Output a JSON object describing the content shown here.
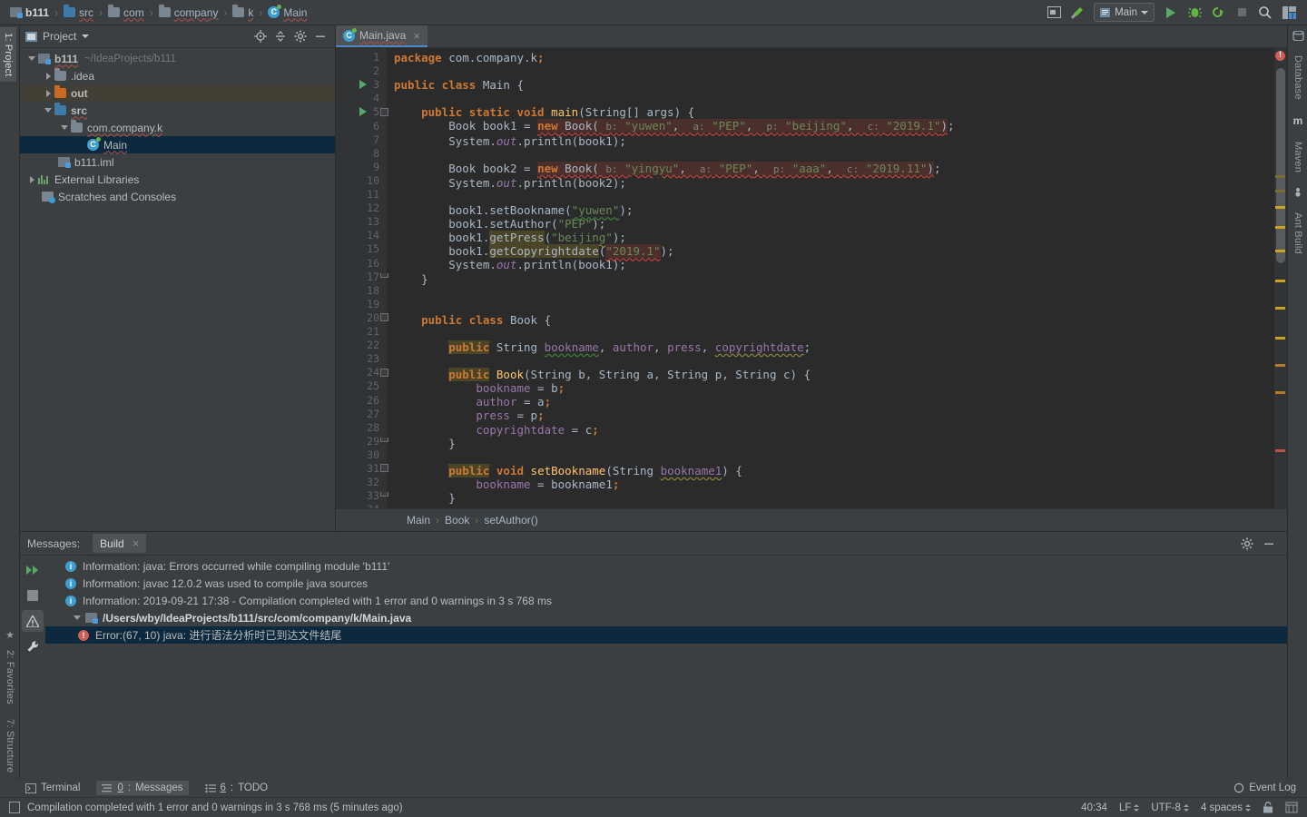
{
  "navbar": {
    "breadcrumbs": [
      {
        "label": "b111",
        "icon": "module-icon",
        "bold": true
      },
      {
        "label": "src",
        "icon": "source-folder-icon",
        "bold": false
      },
      {
        "label": "com",
        "icon": "folder-icon",
        "bold": false
      },
      {
        "label": "company",
        "icon": "folder-icon",
        "bold": false
      },
      {
        "label": "k",
        "icon": "folder-icon",
        "bold": false
      },
      {
        "label": "Main",
        "icon": "java-class-icon",
        "bold": false
      }
    ],
    "separator": "›",
    "run_config": "Main",
    "buttons": {
      "preview": "preview-icon",
      "build": "hammer-icon",
      "run": "run-icon",
      "debug": "debug-icon",
      "run_with_coverage": "coverage-icon",
      "stop": "stop-icon",
      "search": "search-icon",
      "layout": "layout-icon"
    }
  },
  "left_strip": {
    "top": [
      {
        "label": "1: Project",
        "active": true
      }
    ],
    "bottom": [
      {
        "label": "2: Favorites"
      },
      {
        "label": "7: Structure"
      }
    ]
  },
  "right_strip": {
    "items": [
      {
        "label": "Database"
      },
      {
        "label": "Maven"
      },
      {
        "label": "Ant Build"
      }
    ]
  },
  "project_panel": {
    "title": "Project",
    "actions": [
      "locate-icon",
      "collapse-all-icon",
      "settings-gear-icon",
      "hide-icon"
    ],
    "tree": [
      {
        "label": "b111",
        "sublabel": "~/IdeaProjects/b111",
        "depth": 0,
        "arrow": "down",
        "icon": "module-icon",
        "bold": true,
        "selected": false,
        "band": false
      },
      {
        "label": ".idea",
        "sublabel": "",
        "depth": 1,
        "arrow": "right",
        "icon": "folder-grey-icon",
        "bold": false,
        "selected": false,
        "band": false
      },
      {
        "label": "out",
        "sublabel": "",
        "depth": 1,
        "arrow": "right",
        "icon": "folder-out-icon",
        "bold": false,
        "selected": false,
        "band": true
      },
      {
        "label": "src",
        "sublabel": "",
        "depth": 1,
        "arrow": "down",
        "icon": "source-folder-icon",
        "bold": false,
        "selected": false,
        "band": false
      },
      {
        "label": "com.company.k",
        "sublabel": "",
        "depth": 2,
        "arrow": "down",
        "icon": "package-icon",
        "bold": false,
        "selected": false,
        "band": false
      },
      {
        "label": "Main",
        "sublabel": "",
        "depth": 3,
        "arrow": "none",
        "icon": "java-class-icon",
        "bold": false,
        "selected": true,
        "band": false
      },
      {
        "label": "b111.iml",
        "sublabel": "",
        "depth": 1,
        "arrow": "none",
        "icon": "iml-icon",
        "bold": false,
        "selected": false,
        "band": false
      },
      {
        "label": "External Libraries",
        "sublabel": "",
        "depth": 0,
        "arrow": "right",
        "icon": "library-icon",
        "bold": false,
        "selected": false,
        "band": false
      },
      {
        "label": "Scratches and Consoles",
        "sublabel": "",
        "depth": 0,
        "arrow": "none",
        "icon": "scratches-icon",
        "bold": false,
        "selected": false,
        "band": false
      }
    ]
  },
  "editor": {
    "tab": {
      "label": "Main.java",
      "icon": "java-class-icon",
      "close": "×"
    },
    "first_line": 1,
    "last_line": 34,
    "run_marker_lines": [
      3,
      5
    ],
    "fold_start_lines": [
      5,
      20,
      24,
      31
    ],
    "fold_end_lines": [
      17,
      29,
      33
    ],
    "breadcrumb": [
      "Main",
      "Book",
      "setAuthor()"
    ],
    "breadcrumb_separator": "›",
    "lines": [
      {
        "n": 1,
        "text": "    package com.company.k;"
      },
      {
        "n": 2,
        "text": ""
      },
      {
        "n": 3,
        "text": "    public class Main {"
      },
      {
        "n": 4,
        "text": ""
      },
      {
        "n": 5,
        "text": "        public static void main(String[] args) {"
      },
      {
        "n": 6,
        "text": "            Book book1 = new Book( b: \"yuwen\",  a: \"PEP\",  p: \"beijing\",  c: \"2019.1\");"
      },
      {
        "n": 7,
        "text": "            System.out.println(book1);"
      },
      {
        "n": 8,
        "text": ""
      },
      {
        "n": 9,
        "text": "            Book book2 = new Book( b: \"yingyu\",  a: \"PEP\",  p: \"aaa\",  c: \"2019.11\");"
      },
      {
        "n": 10,
        "text": "            System.out.println(book2);"
      },
      {
        "n": 11,
        "text": ""
      },
      {
        "n": 12,
        "text": "            book1.setBookname(\"yuwen\");"
      },
      {
        "n": 13,
        "text": "            book1.setAuthor(\"PEP\");"
      },
      {
        "n": 14,
        "text": "            book1.getPress(\"beijing\");"
      },
      {
        "n": 15,
        "text": "            book1.getCopyrightdate(\"2019.1\");"
      },
      {
        "n": 16,
        "text": "            System.out.println(book1);"
      },
      {
        "n": 17,
        "text": "        }"
      },
      {
        "n": 18,
        "text": ""
      },
      {
        "n": 19,
        "text": ""
      },
      {
        "n": 20,
        "text": "        public class Book {"
      },
      {
        "n": 21,
        "text": ""
      },
      {
        "n": 22,
        "text": "            public String bookname, author, press, copyrightdate;"
      },
      {
        "n": 23,
        "text": ""
      },
      {
        "n": 24,
        "text": "            public Book(String b, String a, String p, String c) {"
      },
      {
        "n": 25,
        "text": "                bookname = b;"
      },
      {
        "n": 26,
        "text": "                author = a;"
      },
      {
        "n": 27,
        "text": "                press = p;"
      },
      {
        "n": 28,
        "text": "                copyrightdate = c;"
      },
      {
        "n": 29,
        "text": "            }"
      },
      {
        "n": 30,
        "text": ""
      },
      {
        "n": 31,
        "text": "            public void setBookname(String bookname1) {"
      },
      {
        "n": 32,
        "text": "                bookname = bookname1;"
      },
      {
        "n": 33,
        "text": "            }"
      },
      {
        "n": 34,
        "text": ""
      }
    ]
  },
  "messages": {
    "label": "Messages:",
    "tab": "Build",
    "tab_close": "×",
    "actions": [
      "settings-gear-icon",
      "hide-icon"
    ],
    "side_buttons": [
      "rerun-icon",
      "stop-icon",
      "warnings-filter-icon",
      "wrench-icon"
    ],
    "rows": [
      {
        "kind": "info",
        "text": "Information: java: Errors occurred while compiling module 'b111'",
        "selected": false,
        "indent": 1
      },
      {
        "kind": "info",
        "text": "Information: javac 12.0.2 was used to compile java sources",
        "selected": false,
        "indent": 1
      },
      {
        "kind": "info",
        "text": "Information: 2019-09-21 17:38 - Compilation completed with 1 error and 0 warnings in 3 s 768 ms",
        "selected": false,
        "indent": 1
      },
      {
        "kind": "path",
        "text": "/Users/wby/IdeaProjects/b111/src/com/company/k/Main.java",
        "selected": false,
        "indent": 0
      },
      {
        "kind": "error",
        "text": "Error:(67, 10)  java: 进行语法分析时已到达文件结尾",
        "selected": true,
        "indent": 2
      }
    ]
  },
  "bottom_tabs": {
    "items": [
      {
        "label": "Terminal",
        "num": "",
        "icon": "terminal-icon",
        "active": false
      },
      {
        "label": "Messages",
        "num": "0",
        "icon": "messages-icon",
        "active": true
      },
      {
        "label": "TODO",
        "num": "6",
        "icon": "todo-icon",
        "active": false
      }
    ],
    "event_log": "Event Log"
  },
  "statusbar": {
    "message": "Compilation completed with 1 error and 0 warnings in 3 s 768 ms (5 minutes ago)",
    "caret": "40:34",
    "line_separator": "LF",
    "encoding": "UTF-8",
    "indent": "4 spaces",
    "lock": "lock-icon",
    "branch": "git-branch-icon"
  },
  "colors": {
    "accent": "#4a88c7",
    "selection": "#0d293e",
    "error": "#cf5b56",
    "warning": "#c9a227",
    "run_green": "#59a869",
    "editor_bg": "#2b2b2b",
    "panel_bg": "#3c3f41"
  }
}
